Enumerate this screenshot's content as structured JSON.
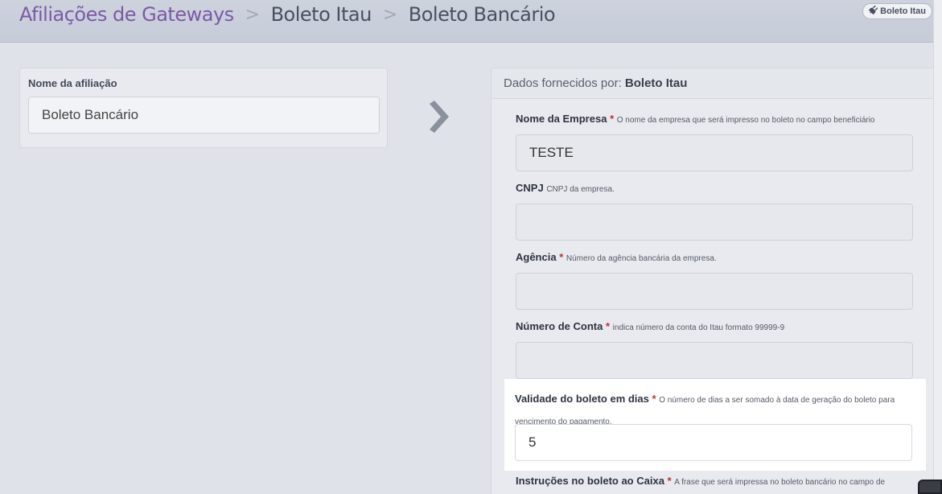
{
  "breadcrumb": {
    "root": "Afiliações de Gateways",
    "separator": ">",
    "gateway": "Boleto Itau",
    "current": "Boleto Bancário"
  },
  "badge": {
    "icon": "plug-icon",
    "label": "Boleto Itau"
  },
  "affiliation": {
    "label": "Nome da afiliação",
    "value": "Boleto Bancário"
  },
  "provider": {
    "prefix": "Dados fornecidos por: ",
    "name": "Boleto Itau"
  },
  "fields": {
    "empresa": {
      "label": "Nome da Empresa",
      "required": "*",
      "hint": "O nome da empresa que será impresso no boleto no campo beneficiário",
      "value": "TESTE"
    },
    "cnpj": {
      "label": "CNPJ",
      "hint": "CNPJ da empresa.",
      "value": ""
    },
    "agencia": {
      "label": "Agência",
      "required": "*",
      "hint": "Número da agência bancária da empresa.",
      "value": ""
    },
    "conta": {
      "label": "Número de Conta",
      "required": "*",
      "hint": "indica número da conta do Itau formato 99999-9",
      "value": ""
    },
    "validade": {
      "label": "Validade do boleto em dias",
      "required": "*",
      "hint": "O número de dias a ser somado à data de geração do boleto para vencimento do pagamento.",
      "value": "5"
    },
    "instrucoes": {
      "label": "Instruções no boleto ao Caixa",
      "required": "*",
      "hint": "A frase que será impressa no boleto bancário no campo de"
    }
  }
}
